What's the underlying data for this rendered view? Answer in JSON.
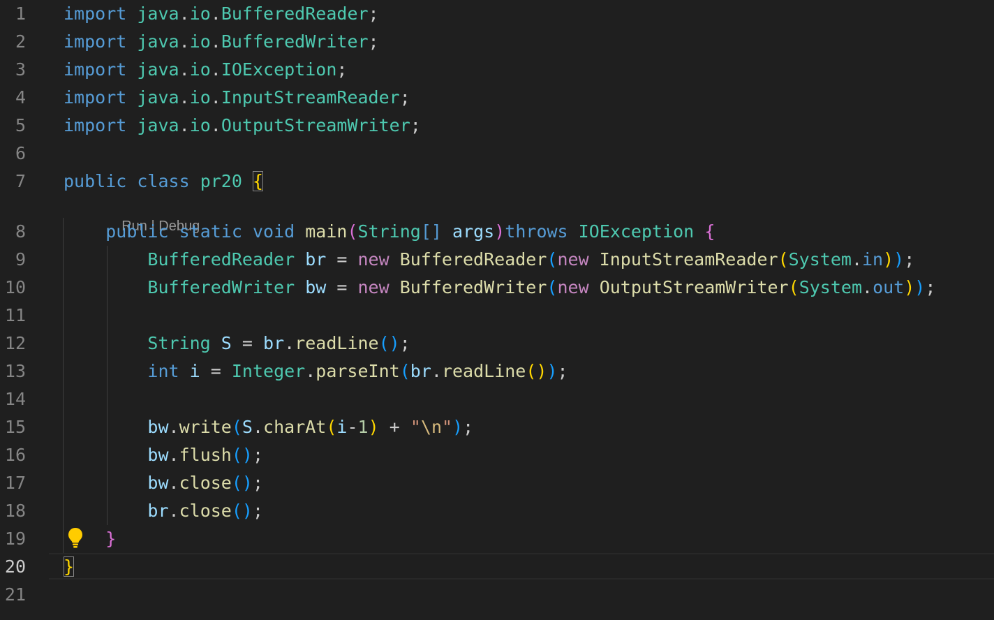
{
  "editor": {
    "line_numbers": [
      "1",
      "2",
      "3",
      "4",
      "5",
      "6",
      "7",
      "8",
      "9",
      "10",
      "11",
      "12",
      "13",
      "14",
      "15",
      "16",
      "17",
      "18",
      "19",
      "20",
      "21"
    ],
    "codelens": {
      "run": "Run",
      "separator": " | ",
      "debug": "Debug"
    },
    "lines": [
      [
        {
          "t": "import",
          "c": "kw"
        },
        {
          "t": " ",
          "c": "pl"
        },
        {
          "t": "java",
          "c": "ty"
        },
        {
          "t": ".",
          "c": "pl"
        },
        {
          "t": "io",
          "c": "ty"
        },
        {
          "t": ".",
          "c": "pl"
        },
        {
          "t": "BufferedReader",
          "c": "ty"
        },
        {
          "t": ";",
          "c": "pl"
        }
      ],
      [
        {
          "t": "import",
          "c": "kw"
        },
        {
          "t": " ",
          "c": "pl"
        },
        {
          "t": "java",
          "c": "ty"
        },
        {
          "t": ".",
          "c": "pl"
        },
        {
          "t": "io",
          "c": "ty"
        },
        {
          "t": ".",
          "c": "pl"
        },
        {
          "t": "BufferedWriter",
          "c": "ty"
        },
        {
          "t": ";",
          "c": "pl"
        }
      ],
      [
        {
          "t": "import",
          "c": "kw"
        },
        {
          "t": " ",
          "c": "pl"
        },
        {
          "t": "java",
          "c": "ty"
        },
        {
          "t": ".",
          "c": "pl"
        },
        {
          "t": "io",
          "c": "ty"
        },
        {
          "t": ".",
          "c": "pl"
        },
        {
          "t": "IOException",
          "c": "ty"
        },
        {
          "t": ";",
          "c": "pl"
        }
      ],
      [
        {
          "t": "import",
          "c": "kw"
        },
        {
          "t": " ",
          "c": "pl"
        },
        {
          "t": "java",
          "c": "ty"
        },
        {
          "t": ".",
          "c": "pl"
        },
        {
          "t": "io",
          "c": "ty"
        },
        {
          "t": ".",
          "c": "pl"
        },
        {
          "t": "InputStreamReader",
          "c": "ty"
        },
        {
          "t": ";",
          "c": "pl"
        }
      ],
      [
        {
          "t": "import",
          "c": "kw"
        },
        {
          "t": " ",
          "c": "pl"
        },
        {
          "t": "java",
          "c": "ty"
        },
        {
          "t": ".",
          "c": "pl"
        },
        {
          "t": "io",
          "c": "ty"
        },
        {
          "t": ".",
          "c": "pl"
        },
        {
          "t": "OutputStreamWriter",
          "c": "ty"
        },
        {
          "t": ";",
          "c": "pl"
        }
      ],
      [],
      [
        {
          "t": "public",
          "c": "kw"
        },
        {
          "t": " ",
          "c": "pl"
        },
        {
          "t": "class",
          "c": "kw"
        },
        {
          "t": " ",
          "c": "pl"
        },
        {
          "t": "pr20",
          "c": "ty"
        },
        {
          "t": " ",
          "c": "pl"
        },
        {
          "t": "{",
          "c": "p1 match"
        }
      ],
      [
        {
          "t": "    ",
          "c": "pl"
        },
        {
          "t": "public",
          "c": "kw"
        },
        {
          "t": " ",
          "c": "pl"
        },
        {
          "t": "static",
          "c": "kw"
        },
        {
          "t": " ",
          "c": "pl"
        },
        {
          "t": "void",
          "c": "kw"
        },
        {
          "t": " ",
          "c": "pl"
        },
        {
          "t": "main",
          "c": "fn"
        },
        {
          "t": "(",
          "c": "p2"
        },
        {
          "t": "String",
          "c": "ty"
        },
        {
          "t": "[]",
          "c": "kw"
        },
        {
          "t": " ",
          "c": "pl"
        },
        {
          "t": "args",
          "c": "var"
        },
        {
          "t": ")",
          "c": "p2"
        },
        {
          "t": "throws",
          "c": "kw"
        },
        {
          "t": " ",
          "c": "pl"
        },
        {
          "t": "IOException",
          "c": "ty"
        },
        {
          "t": " ",
          "c": "pl"
        },
        {
          "t": "{",
          "c": "p2"
        }
      ],
      [
        {
          "t": "        ",
          "c": "pl"
        },
        {
          "t": "BufferedReader",
          "c": "ty"
        },
        {
          "t": " ",
          "c": "pl"
        },
        {
          "t": "br",
          "c": "var"
        },
        {
          "t": " = ",
          "c": "pl"
        },
        {
          "t": "new",
          "c": "kw2"
        },
        {
          "t": " ",
          "c": "pl"
        },
        {
          "t": "BufferedReader",
          "c": "fn"
        },
        {
          "t": "(",
          "c": "p3"
        },
        {
          "t": "new",
          "c": "kw2"
        },
        {
          "t": " ",
          "c": "pl"
        },
        {
          "t": "InputStreamReader",
          "c": "fn"
        },
        {
          "t": "(",
          "c": "p1"
        },
        {
          "t": "System",
          "c": "ty"
        },
        {
          "t": ".",
          "c": "pl"
        },
        {
          "t": "in",
          "c": "kw"
        },
        {
          "t": ")",
          "c": "p1"
        },
        {
          "t": ")",
          "c": "p3"
        },
        {
          "t": ";",
          "c": "pl"
        }
      ],
      [
        {
          "t": "        ",
          "c": "pl"
        },
        {
          "t": "BufferedWriter",
          "c": "ty"
        },
        {
          "t": " ",
          "c": "pl"
        },
        {
          "t": "bw",
          "c": "var"
        },
        {
          "t": " = ",
          "c": "pl"
        },
        {
          "t": "new",
          "c": "kw2"
        },
        {
          "t": " ",
          "c": "pl"
        },
        {
          "t": "BufferedWriter",
          "c": "fn"
        },
        {
          "t": "(",
          "c": "p3"
        },
        {
          "t": "new",
          "c": "kw2"
        },
        {
          "t": " ",
          "c": "pl"
        },
        {
          "t": "OutputStreamWriter",
          "c": "fn"
        },
        {
          "t": "(",
          "c": "p1"
        },
        {
          "t": "System",
          "c": "ty"
        },
        {
          "t": ".",
          "c": "pl"
        },
        {
          "t": "out",
          "c": "kw"
        },
        {
          "t": ")",
          "c": "p1"
        },
        {
          "t": ")",
          "c": "p3"
        },
        {
          "t": ";",
          "c": "pl"
        }
      ],
      [],
      [
        {
          "t": "        ",
          "c": "pl"
        },
        {
          "t": "String",
          "c": "ty"
        },
        {
          "t": " ",
          "c": "pl"
        },
        {
          "t": "S",
          "c": "var"
        },
        {
          "t": " = ",
          "c": "pl"
        },
        {
          "t": "br",
          "c": "var"
        },
        {
          "t": ".",
          "c": "pl"
        },
        {
          "t": "readLine",
          "c": "fn"
        },
        {
          "t": "()",
          "c": "p3"
        },
        {
          "t": ";",
          "c": "pl"
        }
      ],
      [
        {
          "t": "        ",
          "c": "pl"
        },
        {
          "t": "int",
          "c": "kw"
        },
        {
          "t": " ",
          "c": "pl"
        },
        {
          "t": "i",
          "c": "var"
        },
        {
          "t": " = ",
          "c": "pl"
        },
        {
          "t": "Integer",
          "c": "ty"
        },
        {
          "t": ".",
          "c": "pl"
        },
        {
          "t": "parseInt",
          "c": "fn"
        },
        {
          "t": "(",
          "c": "p3"
        },
        {
          "t": "br",
          "c": "var"
        },
        {
          "t": ".",
          "c": "pl"
        },
        {
          "t": "readLine",
          "c": "fn"
        },
        {
          "t": "()",
          "c": "p1"
        },
        {
          "t": ")",
          "c": "p3"
        },
        {
          "t": ";",
          "c": "pl"
        }
      ],
      [],
      [
        {
          "t": "        ",
          "c": "pl"
        },
        {
          "t": "bw",
          "c": "var"
        },
        {
          "t": ".",
          "c": "pl"
        },
        {
          "t": "write",
          "c": "fn"
        },
        {
          "t": "(",
          "c": "p3"
        },
        {
          "t": "S",
          "c": "var"
        },
        {
          "t": ".",
          "c": "pl"
        },
        {
          "t": "charAt",
          "c": "fn"
        },
        {
          "t": "(",
          "c": "p1"
        },
        {
          "t": "i",
          "c": "var"
        },
        {
          "t": "-",
          "c": "pl"
        },
        {
          "t": "1",
          "c": "num"
        },
        {
          "t": ")",
          "c": "p1"
        },
        {
          "t": " + ",
          "c": "pl"
        },
        {
          "t": "\"",
          "c": "str"
        },
        {
          "t": "\\n",
          "c": "esc"
        },
        {
          "t": "\"",
          "c": "str"
        },
        {
          "t": ")",
          "c": "p3"
        },
        {
          "t": ";",
          "c": "pl"
        }
      ],
      [
        {
          "t": "        ",
          "c": "pl"
        },
        {
          "t": "bw",
          "c": "var"
        },
        {
          "t": ".",
          "c": "pl"
        },
        {
          "t": "flush",
          "c": "fn"
        },
        {
          "t": "()",
          "c": "p3"
        },
        {
          "t": ";",
          "c": "pl"
        }
      ],
      [
        {
          "t": "        ",
          "c": "pl"
        },
        {
          "t": "bw",
          "c": "var"
        },
        {
          "t": ".",
          "c": "pl"
        },
        {
          "t": "close",
          "c": "fn"
        },
        {
          "t": "()",
          "c": "p3"
        },
        {
          "t": ";",
          "c": "pl"
        }
      ],
      [
        {
          "t": "        ",
          "c": "pl"
        },
        {
          "t": "br",
          "c": "var"
        },
        {
          "t": ".",
          "c": "pl"
        },
        {
          "t": "close",
          "c": "fn"
        },
        {
          "t": "()",
          "c": "p3"
        },
        {
          "t": ";",
          "c": "pl"
        }
      ],
      [
        {
          "t": "    ",
          "c": "pl"
        },
        {
          "t": "}",
          "c": "p2"
        }
      ],
      [
        {
          "t": "}",
          "c": "p1 match"
        }
      ],
      []
    ],
    "active_line": "20",
    "colors": {
      "background": "#1f1f1f",
      "keyword": "#569cd6",
      "control_keyword": "#c586c0",
      "type": "#4ec9b0",
      "function": "#dcdcaa",
      "variable": "#9cdcfe",
      "number": "#b5cea8",
      "string": "#ce9178",
      "bracket_gold": "#ffd700",
      "bracket_orchid": "#da70d6",
      "bracket_blue": "#179fff",
      "line_number": "#858585",
      "lightbulb": "#ffcc00"
    },
    "icons": {
      "quick_fix": "lightbulb-icon"
    }
  }
}
